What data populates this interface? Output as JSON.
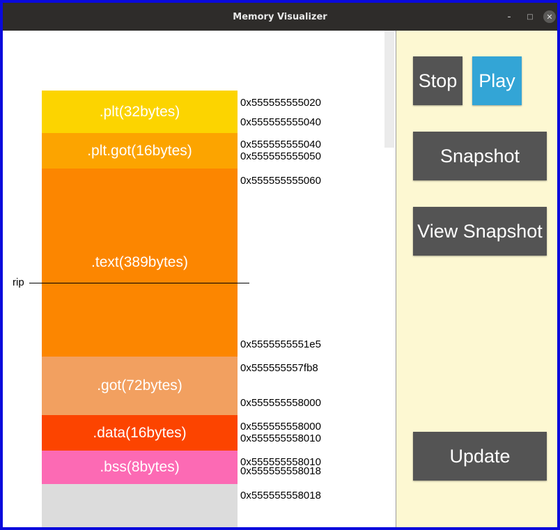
{
  "window": {
    "title": "Memory Visualizer",
    "minimize_glyph": "–",
    "maximize_glyph": "□",
    "close_glyph": "✕"
  },
  "memory": {
    "segments": [
      {
        "label": ".plt(32bytes)",
        "color": "#fcd400",
        "start": "0x555555555020",
        "end": "0x555555555040"
      },
      {
        "label": ".plt.got(16bytes)",
        "color": "#fca400",
        "start": "0x555555555040",
        "end": "0x555555555050"
      },
      {
        "label": ".text(389bytes)",
        "color": "#fc8600",
        "start": "0x555555555060",
        "end": "0x5555555551e5"
      },
      {
        "label": ".got(72bytes)",
        "color": "#f2a060",
        "start": "0x555555557fb8",
        "end": "0x555555558000"
      },
      {
        "label": ".data(16bytes)",
        "color": "#fc4400",
        "start": "0x555555558000",
        "end": "0x555555558010"
      },
      {
        "label": ".bss(8bytes)",
        "color": "#fc6ab4",
        "start": "0x555555558010",
        "end": "0x555555558018"
      },
      {
        "label": "",
        "color": "#dcdcdc",
        "start": "0x555555558018",
        "end": ""
      }
    ],
    "pointer_label": "rip"
  },
  "controls": {
    "stop_label": "Stop",
    "play_label": "Play",
    "snapshot_label": "Snapshot",
    "view_snapshot_label": "View Snapshot",
    "update_label": "Update"
  }
}
